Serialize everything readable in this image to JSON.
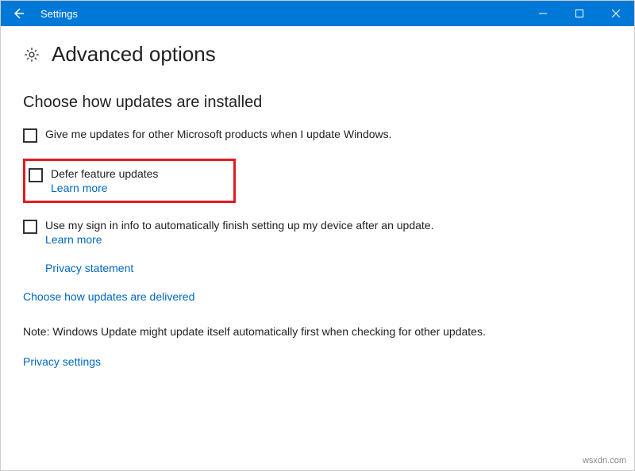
{
  "titlebar": {
    "title": "Settings"
  },
  "page": {
    "title": "Advanced options",
    "section_heading": "Choose how updates are installed"
  },
  "options": {
    "other_products": {
      "label": "Give me updates for other Microsoft products when I update Windows."
    },
    "defer_updates": {
      "label": "Defer feature updates",
      "learn_more": "Learn more"
    },
    "sign_in_info": {
      "label": "Use my sign in info to automatically finish setting up my device after an update.",
      "learn_more": "Learn more"
    }
  },
  "links": {
    "privacy_statement": "Privacy statement",
    "delivery": "Choose how updates are delivered",
    "privacy_settings": "Privacy settings"
  },
  "note": "Note: Windows Update might update itself automatically first when checking for other updates.",
  "watermark": "wsxdn.com"
}
